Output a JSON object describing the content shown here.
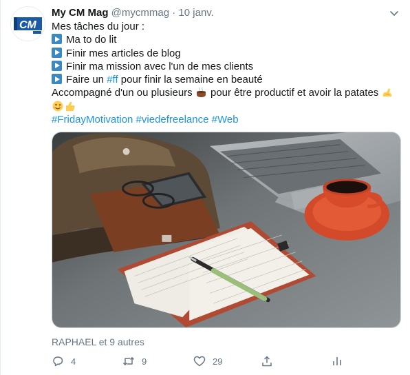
{
  "author": {
    "display_name": "My CM Mag",
    "handle": "@mycmmag",
    "separator": "·",
    "date": "10 janv.",
    "avatar_text": "CM"
  },
  "tweet": {
    "intro": "Mes tâches du jour :",
    "tasks": [
      "Ma to do lit",
      "Finir mes articles de blog",
      "Finir ma mission avec l'un de mes clients"
    ],
    "task4_before": "Faire un ",
    "task4_link": "#ff",
    "task4_after": " pour finir la semaine en beauté",
    "closing_before": "Accompagné d'un ou plusieurs ",
    "closing_after": " pour être productif et avoir la patates",
    "hashtags": "#FridayMotivation #viedefreelance #Web",
    "emojis": [
      "hot-beverage-icon",
      "flexed-biceps-icon",
      "winking-face-icon",
      "thumbs-up-icon"
    ]
  },
  "media": {
    "description_icon": "desk-photo"
  },
  "social": {
    "likes_line": "RAPHAEL et 9 autres"
  },
  "actions": {
    "reply_count": "4",
    "retweet_count": "9",
    "like_count": "29"
  },
  "colors": {
    "link": "#1b95e0",
    "secondary_text": "#657786",
    "play_icon": "#3b88c3"
  }
}
